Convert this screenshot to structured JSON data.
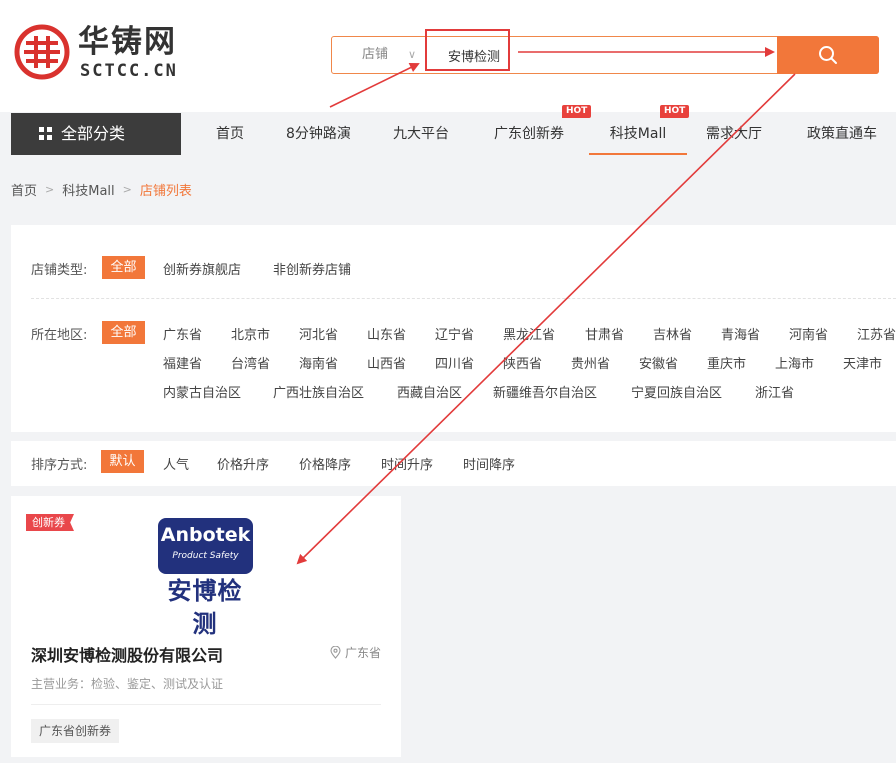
{
  "brand": {
    "logo_cn": "华铸网",
    "logo_en": "SCTCC.CN"
  },
  "search": {
    "type_label": "店铺",
    "query": "安博检测"
  },
  "nav": {
    "all_categories": "全部分类",
    "items": [
      {
        "label": "首页"
      },
      {
        "label": "8分钟路演"
      },
      {
        "label": "九大平台"
      },
      {
        "label": "广东创新券",
        "badge": "HOT"
      },
      {
        "label": "科技Mall",
        "badge": "HOT"
      },
      {
        "label": "需求大厅"
      },
      {
        "label": "政策直通车"
      }
    ]
  },
  "breadcrumb": [
    "首页",
    "科技Mall",
    "店铺列表"
  ],
  "filters": {
    "shop_type": {
      "label": "店铺类型:",
      "all": "全部",
      "options": [
        "创新券旗舰店",
        "非创新券店铺"
      ]
    },
    "region": {
      "label": "所在地区:",
      "all": "全部",
      "row1": [
        "广东省",
        "北京市",
        "河北省",
        "山东省",
        "辽宁省",
        "黑龙江省",
        "甘肃省",
        "吉林省",
        "青海省",
        "河南省",
        "江苏省"
      ],
      "row2": [
        "福建省",
        "台湾省",
        "海南省",
        "山西省",
        "四川省",
        "陕西省",
        "贵州省",
        "安徽省",
        "重庆市",
        "上海市",
        "天津市"
      ],
      "row3": [
        "内蒙古自治区",
        "广西壮族自治区",
        "西藏自治区",
        "新疆维吾尔自治区",
        "宁夏回族自治区",
        "浙江省"
      ]
    }
  },
  "sort": {
    "label": "排序方式:",
    "default": "默认",
    "options": [
      "人气",
      "价格升序",
      "价格降序",
      "时间升序",
      "时间降序"
    ]
  },
  "shop_card": {
    "ribbon": "创新券",
    "logo_name": "Anbotek",
    "logo_sub": "Product Safety",
    "logo_cn": "安博检测",
    "company": "深圳安博检测股份有限公司",
    "location": "广东省",
    "business": "主营业务：检验、鉴定、测试及认证",
    "tag": "广东省创新券"
  },
  "colors": {
    "accent": "#f2773a",
    "annotation": "#e23b3b",
    "brand_navy": "#22317d"
  }
}
